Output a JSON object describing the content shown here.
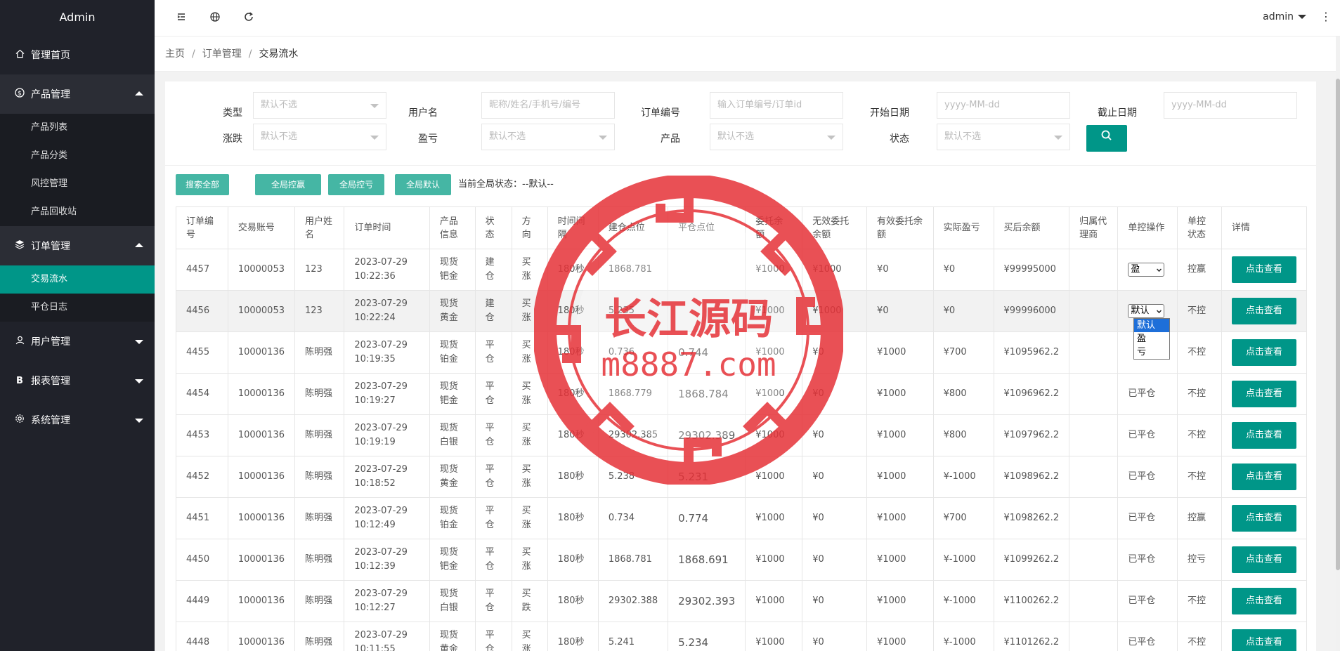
{
  "sidebar": {
    "logo": "Admin",
    "items": [
      {
        "label": "管理首页",
        "icon": "home-icon"
      },
      {
        "label": "产品管理",
        "icon": "dollar-icon",
        "open": true,
        "children": [
          "产品列表",
          "产品分类",
          "风控管理",
          "产品回收站"
        ]
      },
      {
        "label": "订单管理",
        "icon": "layers-icon",
        "open": true,
        "children": [
          "交易流水",
          "平仓日志"
        ]
      },
      {
        "label": "用户管理",
        "icon": "user-icon"
      },
      {
        "label": "报表管理",
        "icon": "report-b-icon"
      },
      {
        "label": "系统管理",
        "icon": "gear-icon"
      }
    ],
    "active_child": "交易流水"
  },
  "header": {
    "user": "admin",
    "icons": [
      "menu-fold-icon",
      "globe-icon",
      "refresh-icon",
      "more-vertical-icon"
    ]
  },
  "breadcrumb": {
    "home": "主页",
    "section": "订单管理",
    "current": "交易流水"
  },
  "filters": {
    "type": {
      "label": "类型",
      "placeholder": "默认不选"
    },
    "username": {
      "label": "用户名",
      "placeholder": "昵称/姓名/手机号/编号"
    },
    "order_no": {
      "label": "订单编号",
      "placeholder": "输入订单编号/订单id"
    },
    "start_date": {
      "label": "开始日期",
      "placeholder": "yyyy-MM-dd"
    },
    "end_date": {
      "label": "截止日期",
      "placeholder": "yyyy-MM-dd"
    },
    "rise_fall": {
      "label": "涨跌",
      "placeholder": "默认不选"
    },
    "profit_loss": {
      "label": "盈亏",
      "placeholder": "默认不选"
    },
    "product": {
      "label": "产品",
      "placeholder": "默认不选"
    },
    "status": {
      "label": "状态",
      "placeholder": "默认不选"
    }
  },
  "actions": {
    "search_all": "搜索全部",
    "global_win": "全局控赢",
    "global_lose": "全局控亏",
    "global_default": "全局默认",
    "current_status": "当前全局状态：--默认--"
  },
  "table": {
    "headers": [
      "订单编号",
      "交易账号",
      "用户姓名",
      "订单时间",
      "产品信息",
      "状态",
      "方向",
      "时间间隔",
      "建仓点位",
      "平仓点位",
      "委托余额",
      "无效委托余额",
      "有效委托余额",
      "实际盈亏",
      "买后余额",
      "归属代理商",
      "单控操作",
      "单控状态",
      "详情"
    ],
    "detail_label": "点击查看",
    "rows": [
      {
        "id": "4457",
        "acct": "10000053",
        "name": "123",
        "time": "2023-07-29 10:22:36",
        "product": "现货钯金",
        "status": "建仓",
        "dir": "买涨",
        "dir_color": "red",
        "interval": "180秒",
        "open": "1868.781",
        "close": "",
        "close_color": "",
        "amount": "¥1000",
        "invalid": "¥1000",
        "valid": "¥0",
        "pnl": "¥0",
        "after": "¥99995000",
        "agent": "",
        "ctrl_select": "盈",
        "ctrl_text": "",
        "ctrl_state": "控赢",
        "ctrl_state_color": "red"
      },
      {
        "id": "4456",
        "acct": "10000053",
        "name": "123",
        "time": "2023-07-29 10:22:24",
        "product": "现货黄金",
        "status": "建仓",
        "dir": "买涨",
        "dir_color": "red",
        "interval": "180秒",
        "open": "5.235",
        "close": "",
        "close_color": "",
        "amount": "¥1000",
        "invalid": "¥1000",
        "valid": "¥0",
        "pnl": "¥0",
        "after": "¥99996000",
        "agent": "",
        "ctrl_select": "默认",
        "ctrl_text": "",
        "ctrl_state": "不控",
        "ctrl_state_color": ""
      },
      {
        "id": "4455",
        "acct": "10000136",
        "name": "陈明强",
        "time": "2023-07-29 10:19:35",
        "product": "现货铂金",
        "status": "平仓",
        "dir": "买涨",
        "dir_color": "red",
        "interval": "180秒",
        "open": "0.736",
        "close": "0.744",
        "close_color": "red",
        "amount": "¥1000",
        "invalid": "¥0",
        "valid": "¥1000",
        "pnl": "¥700",
        "after": "¥1095962.2",
        "agent": "",
        "ctrl_select": "",
        "ctrl_text": "",
        "ctrl_state": "不控",
        "ctrl_state_color": ""
      },
      {
        "id": "4454",
        "acct": "10000136",
        "name": "陈明强",
        "time": "2023-07-29 10:19:27",
        "product": "现货钯金",
        "status": "平仓",
        "dir": "买涨",
        "dir_color": "red",
        "interval": "180秒",
        "open": "1868.779",
        "close": "1868.784",
        "close_color": "red",
        "amount": "¥1000",
        "invalid": "¥0",
        "valid": "¥1000",
        "pnl": "¥800",
        "after": "¥1096962.2",
        "agent": "",
        "ctrl_select": "",
        "ctrl_text": "已平仓",
        "ctrl_state": "不控",
        "ctrl_state_color": ""
      },
      {
        "id": "4453",
        "acct": "10000136",
        "name": "陈明强",
        "time": "2023-07-29 10:19:19",
        "product": "现货白银",
        "status": "平仓",
        "dir": "买涨",
        "dir_color": "red",
        "interval": "180秒",
        "open": "29302.385",
        "close": "29302.389",
        "close_color": "red",
        "amount": "¥1000",
        "invalid": "¥0",
        "valid": "¥1000",
        "pnl": "¥800",
        "after": "¥1097962.2",
        "agent": "",
        "ctrl_select": "",
        "ctrl_text": "已平仓",
        "ctrl_state": "不控",
        "ctrl_state_color": ""
      },
      {
        "id": "4452",
        "acct": "10000136",
        "name": "陈明强",
        "time": "2023-07-29 10:18:52",
        "product": "现货黄金",
        "status": "平仓",
        "dir": "买涨",
        "dir_color": "red",
        "interval": "180秒",
        "open": "5.238",
        "close": "5.231",
        "close_color": "green",
        "amount": "¥1000",
        "invalid": "¥0",
        "valid": "¥1000",
        "pnl": "¥-1000",
        "after": "¥1098962.2",
        "agent": "",
        "ctrl_select": "",
        "ctrl_text": "已平仓",
        "ctrl_state": "不控",
        "ctrl_state_color": ""
      },
      {
        "id": "4451",
        "acct": "10000136",
        "name": "陈明强",
        "time": "2023-07-29 10:12:49",
        "product": "现货铂金",
        "status": "平仓",
        "dir": "买涨",
        "dir_color": "red",
        "interval": "180秒",
        "open": "0.734",
        "close": "0.774",
        "close_color": "red",
        "amount": "¥1000",
        "invalid": "¥0",
        "valid": "¥1000",
        "pnl": "¥700",
        "after": "¥1098262.2",
        "agent": "",
        "ctrl_select": "",
        "ctrl_text": "已平仓",
        "ctrl_state": "控赢",
        "ctrl_state_color": "red"
      },
      {
        "id": "4450",
        "acct": "10000136",
        "name": "陈明强",
        "time": "2023-07-29 10:12:39",
        "product": "现货钯金",
        "status": "平仓",
        "dir": "买涨",
        "dir_color": "red",
        "interval": "180秒",
        "open": "1868.781",
        "close": "1868.691",
        "close_color": "green",
        "amount": "¥1000",
        "invalid": "¥0",
        "valid": "¥1000",
        "pnl": "¥-1000",
        "after": "¥1099262.2",
        "agent": "",
        "ctrl_select": "",
        "ctrl_text": "已平仓",
        "ctrl_state": "控亏",
        "ctrl_state_color": "green"
      },
      {
        "id": "4449",
        "acct": "10000136",
        "name": "陈明强",
        "time": "2023-07-29 10:12:27",
        "product": "现货白银",
        "status": "平仓",
        "dir": "买跌",
        "dir_color": "green",
        "interval": "180秒",
        "open": "29302.388",
        "close": "29302.393",
        "close_color": "red",
        "amount": "¥1000",
        "invalid": "¥0",
        "valid": "¥1000",
        "pnl": "¥-1000",
        "after": "¥1100262.2",
        "agent": "",
        "ctrl_select": "",
        "ctrl_text": "已平仓",
        "ctrl_state": "不控",
        "ctrl_state_color": ""
      },
      {
        "id": "4448",
        "acct": "10000136",
        "name": "陈明强",
        "time": "2023-07-29 10:11:55",
        "product": "现货黄金",
        "status": "平仓",
        "dir": "买涨",
        "dir_color": "red",
        "interval": "180秒",
        "open": "5.241",
        "close": "5.234",
        "close_color": "green",
        "amount": "¥1000",
        "invalid": "¥0",
        "valid": "¥1000",
        "pnl": "¥-1000",
        "after": "¥1101262.2",
        "agent": "",
        "ctrl_select": "",
        "ctrl_text": "已平仓",
        "ctrl_state": "不控",
        "ctrl_state_color": ""
      }
    ]
  },
  "dropdown_options": [
    "默认",
    "盈",
    "亏"
  ],
  "dropdown_selected": "默认",
  "watermark": {
    "line1": "长江源码",
    "line2": "m8887.com",
    "color": "#e63238"
  },
  "colors": {
    "primary": "#009688",
    "sidebar": "#20222a",
    "red": "#e6312e",
    "green": "#19a84d"
  }
}
